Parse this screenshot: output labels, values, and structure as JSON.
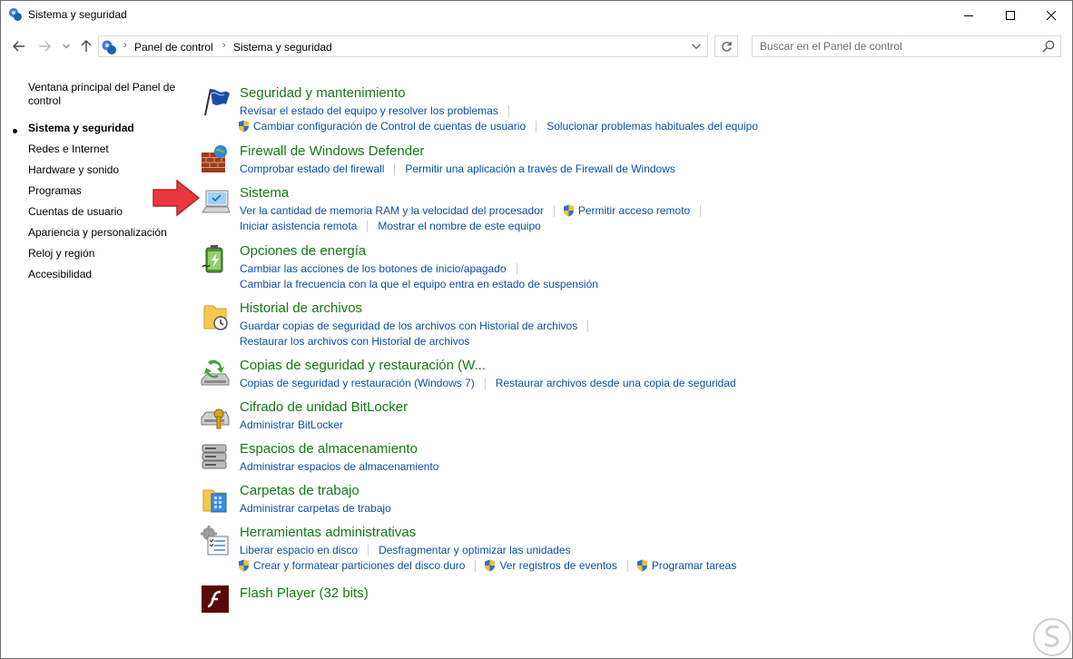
{
  "window": {
    "title": "Sistema y seguridad"
  },
  "address": {
    "crumbs": [
      "Panel de control",
      "Sistema y seguridad"
    ],
    "search_placeholder": "Buscar en el Panel de control"
  },
  "leftpane": {
    "items": [
      {
        "label": "Ventana principal del Panel de control"
      },
      {
        "label": "Sistema y seguridad"
      },
      {
        "label": "Redes e Internet"
      },
      {
        "label": "Hardware y sonido"
      },
      {
        "label": "Programas"
      },
      {
        "label": "Cuentas de usuario"
      },
      {
        "label": "Apariencia y personalización"
      },
      {
        "label": "Reloj y región"
      },
      {
        "label": "Accesibilidad"
      }
    ]
  },
  "categories": [
    {
      "title": "Seguridad y mantenimiento",
      "icon": "flag-icon",
      "rows": [
        [
          "Revisar el estado del equipo y resolver los problemas"
        ],
        [
          "Cambiar configuración de Control de cuentas de usuario",
          "Solucionar problemas habituales del equipo"
        ]
      ]
    },
    {
      "title": "Firewall de Windows Defender",
      "icon": "firewall-icon",
      "rows": [
        [
          "Comprobar estado del firewall",
          "Permitir una aplicación a través de Firewall de Windows"
        ]
      ]
    },
    {
      "title": "Sistema",
      "icon": "computer-icon",
      "rows": [
        [
          "Ver la cantidad de memoria RAM y la velocidad del procesador",
          "Permitir acceso remoto"
        ],
        [
          "Iniciar asistencia remota",
          "Mostrar el nombre de este equipo"
        ]
      ]
    },
    {
      "title": "Opciones de energía",
      "icon": "battery-icon",
      "rows": [
        [
          "Cambiar las acciones de los botones de inicio/apagado"
        ],
        [
          "Cambiar la frecuencia con la que el equipo entra en estado de suspensión"
        ]
      ]
    },
    {
      "title": "Historial de archivos",
      "icon": "file-history-icon",
      "rows": [
        [
          "Guardar copias de seguridad de los archivos con Historial de archivos"
        ],
        [
          "Restaurar los archivos con Historial de archivos"
        ]
      ]
    },
    {
      "title": "Copias de seguridad y restauración (W...",
      "icon": "backup-icon",
      "rows": [
        [
          "Copias de seguridad y restauración (Windows 7)",
          "Restaurar archivos desde una copia de seguridad"
        ]
      ]
    },
    {
      "title": "Cifrado de unidad BitLocker",
      "icon": "bitlocker-icon",
      "rows": [
        [
          "Administrar BitLocker"
        ]
      ]
    },
    {
      "title": "Espacios de almacenamiento",
      "icon": "storage-icon",
      "rows": [
        [
          "Administrar espacios de almacenamiento"
        ]
      ]
    },
    {
      "title": "Carpetas de trabajo",
      "icon": "work-folders-icon",
      "rows": [
        [
          "Administrar carpetas de trabajo"
        ]
      ]
    },
    {
      "title": "Herramientas administrativas",
      "icon": "admin-tools-icon",
      "rows": [
        [
          "Liberar espacio en disco",
          "Desfragmentar y optimizar las unidades"
        ],
        [
          "Crear y formatear particiones del disco duro",
          "Ver registros de eventos",
          "Programar tareas"
        ]
      ]
    },
    {
      "title": "Flash Player (32 bits)",
      "icon": "flash-icon",
      "rows": []
    }
  ],
  "colors": {
    "title_green": "#0f7d0f",
    "link_blue": "#0a4fa8",
    "annotation_red": "#e8383d"
  }
}
